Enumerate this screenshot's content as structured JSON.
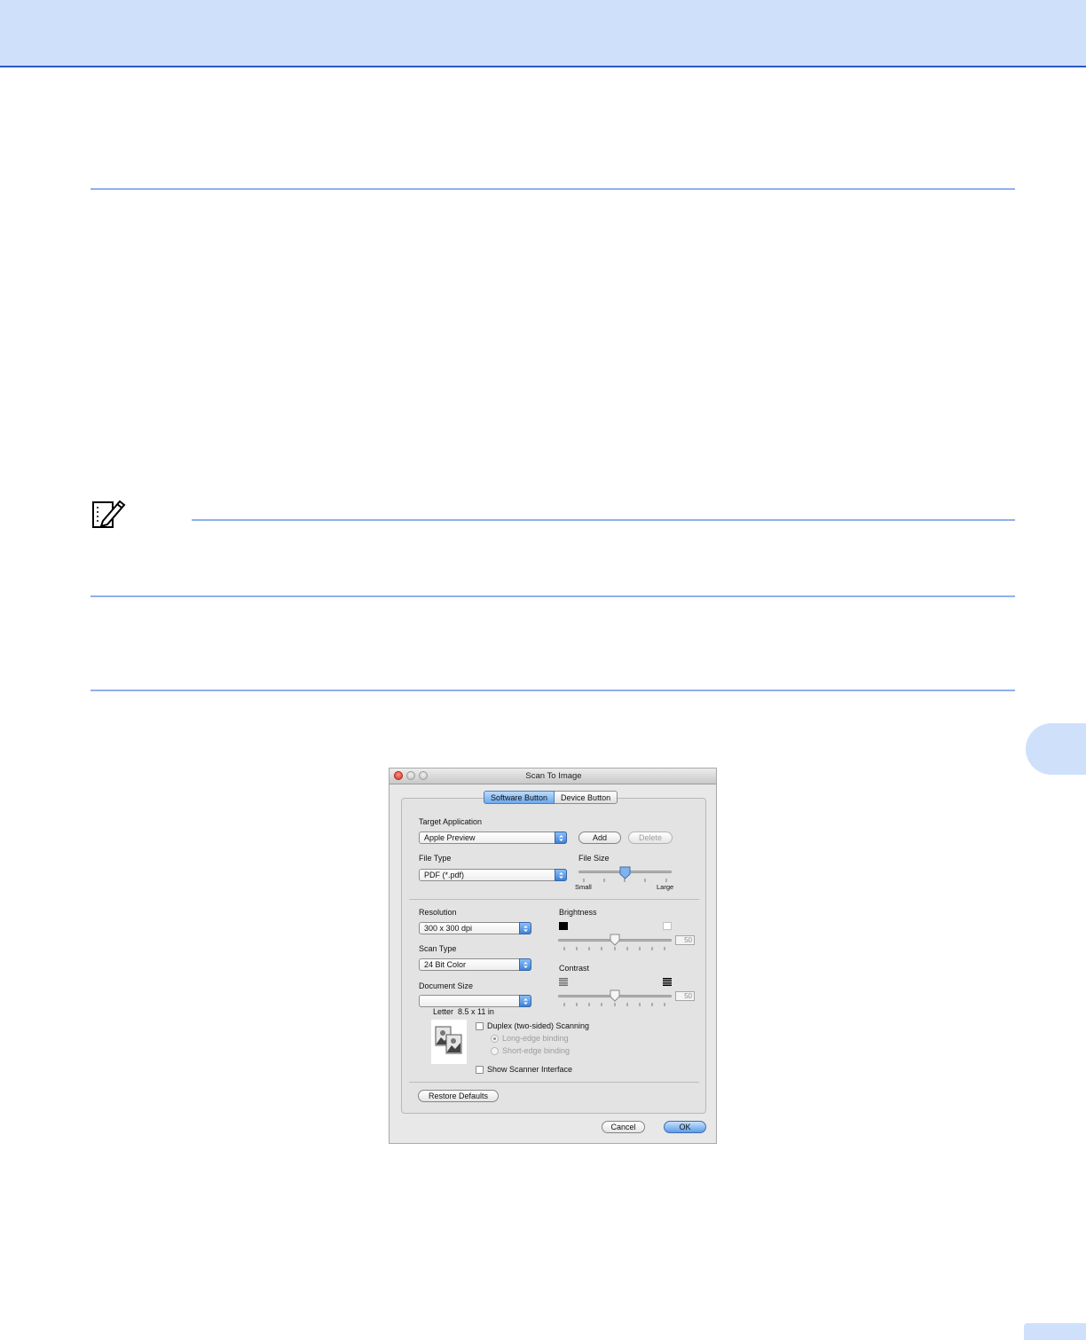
{
  "dialog": {
    "title": "Scan To Image",
    "tabs": [
      "Software Button",
      "Device Button"
    ],
    "target_application": {
      "label": "Target Application",
      "value": "Apple Preview",
      "add_label": "Add",
      "delete_label": "Delete"
    },
    "file_type": {
      "label": "File Type",
      "value": "PDF (*.pdf)"
    },
    "file_size": {
      "label": "File Size",
      "min_label": "Small",
      "max_label": "Large",
      "level": 0.5
    },
    "resolution": {
      "label": "Resolution",
      "value": "300 x 300 dpi"
    },
    "scan_type": {
      "label": "Scan Type",
      "value": "24 Bit Color"
    },
    "document_size": {
      "label": "Document Size",
      "value": "Letter  8.5 x 11 in"
    },
    "brightness": {
      "label": "Brightness",
      "value": "50"
    },
    "contrast": {
      "label": "Contrast",
      "value": "50"
    },
    "duplex": {
      "label": "Duplex (two-sided) Scanning",
      "long_edge": "Long-edge binding",
      "short_edge": "Short-edge binding"
    },
    "show_scanner_interface": "Show Scanner Interface",
    "restore_defaults": "Restore Defaults",
    "cancel": "Cancel",
    "ok": "OK"
  },
  "colors": {
    "header_band": "#cfe0fb",
    "header_line": "#2c56c9",
    "rule": "#8fb1ec",
    "selection_blue": "#5c9cea"
  }
}
